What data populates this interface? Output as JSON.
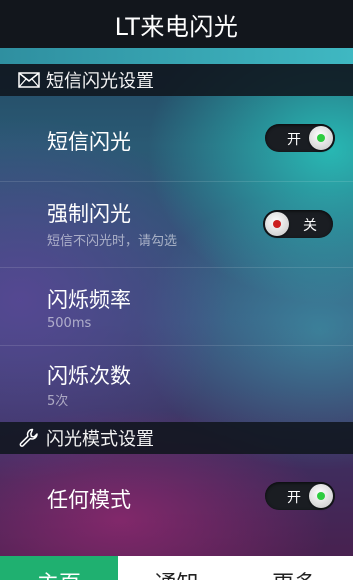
{
  "app": {
    "title": "LT来电闪光"
  },
  "sections": {
    "sms": {
      "header": "短信闪光设置",
      "icon": "envelope-icon"
    },
    "mode": {
      "header": "闪光模式设置",
      "icon": "wrench-icon"
    }
  },
  "settings": {
    "sms_flash": {
      "label": "短信闪光",
      "toggle_text": "开",
      "state": "on"
    },
    "force_flash": {
      "label": "强制闪光",
      "hint": "短信不闪光时，请勾选",
      "toggle_text": "关",
      "state": "off"
    },
    "flash_frequency": {
      "label": "闪烁频率",
      "value": "500ms"
    },
    "flash_count": {
      "label": "闪烁次数",
      "value": "5次"
    },
    "any_mode": {
      "label": "任何模式",
      "toggle_text": "开",
      "state": "on"
    }
  },
  "tabs": [
    {
      "label": "主页",
      "active": true
    },
    {
      "label": "通知",
      "active": false
    },
    {
      "label": "更多",
      "active": false
    }
  ],
  "colors": {
    "accent_green": "#1fb070",
    "toggle_on_dot": "#2ecc40",
    "toggle_off_dot": "#cc1f1f",
    "title_bar": "#12161c"
  }
}
